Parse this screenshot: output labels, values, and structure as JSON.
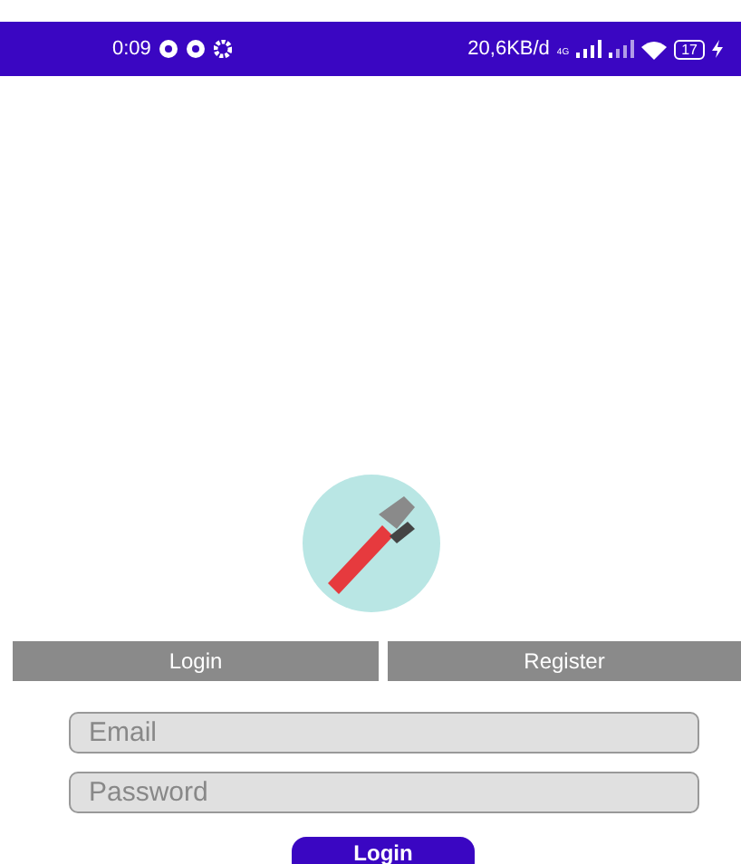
{
  "status_bar": {
    "time": "0:09",
    "speed": "20,6KB/d",
    "network": "4G",
    "battery": "17"
  },
  "tabs": [
    {
      "label": "Login"
    },
    {
      "label": "Register"
    }
  ],
  "form": {
    "email": {
      "placeholder": "Email"
    },
    "password": {
      "placeholder": "Password"
    },
    "submit": "Login"
  }
}
